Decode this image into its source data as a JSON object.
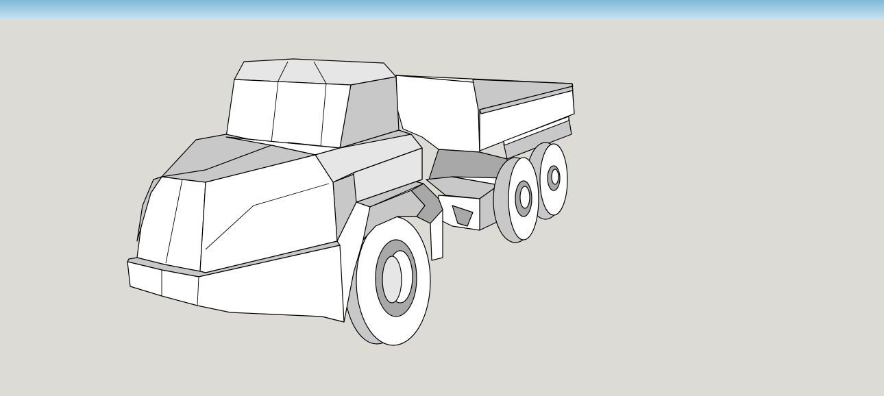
{
  "scene": {
    "sky_color_top": "#7fb9d6",
    "sky_color_bottom": "#c9e2ee",
    "ground_color": "#dcdbd6",
    "face_light": "#ffffff",
    "face_mid": "#e6e6e6",
    "face_shade": "#c8c8c8",
    "face_dark": "#a8a8a8",
    "face_inner": "#8c8c8c"
  },
  "model": {
    "object": "articulated-dump-truck",
    "wheels": [
      "front-wheel",
      "middle-rear-wheel",
      "back-rear-wheel"
    ]
  }
}
